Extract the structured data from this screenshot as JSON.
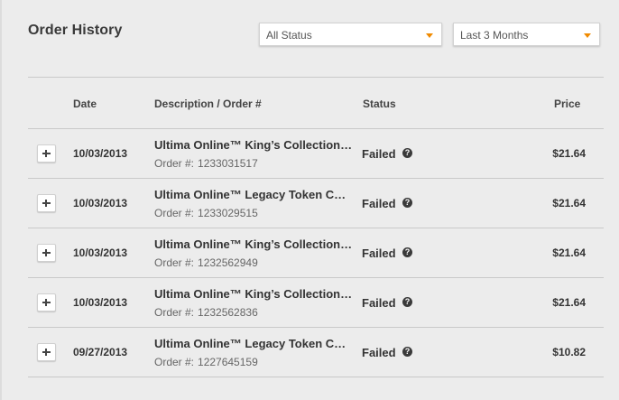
{
  "header": {
    "title": "Order History"
  },
  "filters": {
    "status": {
      "selected": "All Status"
    },
    "period": {
      "selected": "Last 3 Months"
    }
  },
  "columns": {
    "date": "Date",
    "description": "Description / Order #",
    "status": "Status",
    "price": "Price"
  },
  "colors": {
    "accent": "#f08a00",
    "background": "#ececec"
  },
  "orders": [
    {
      "date": "10/03/2013",
      "description": "Ultima Online™ King’s Collection…",
      "order_label": "Order #:",
      "order_number": "1233031517",
      "status": "Failed",
      "price": "$21.64"
    },
    {
      "date": "10/03/2013",
      "description": "Ultima Online™ Legacy Token C…",
      "order_label": "Order #:",
      "order_number": "1233029515",
      "status": "Failed",
      "price": "$21.64"
    },
    {
      "date": "10/03/2013",
      "description": "Ultima Online™ King’s Collection…",
      "order_label": "Order #:",
      "order_number": "1232562949",
      "status": "Failed",
      "price": "$21.64"
    },
    {
      "date": "10/03/2013",
      "description": "Ultima Online™ King’s Collection…",
      "order_label": "Order #:",
      "order_number": "1232562836",
      "status": "Failed",
      "price": "$21.64"
    },
    {
      "date": "09/27/2013",
      "description": "Ultima Online™ Legacy Token C…",
      "order_label": "Order #:",
      "order_number": "1227645159",
      "status": "Failed",
      "price": "$10.82"
    }
  ],
  "icons": {
    "expand": "plus-icon",
    "help": "question-circle-icon",
    "dropdown": "chevron-down-icon"
  }
}
